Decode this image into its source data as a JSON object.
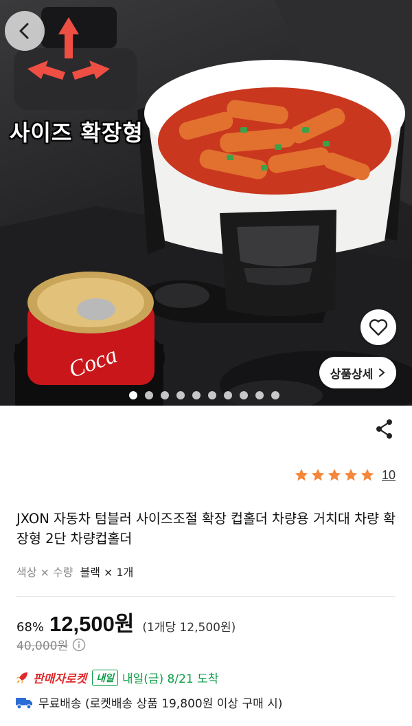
{
  "hero": {
    "size_label": "사이즈 확장형",
    "detail_button_label": "상품상세",
    "carousel": {
      "total": 10,
      "active_index": 0
    }
  },
  "product": {
    "rating": 5,
    "review_count": "10",
    "title": "JXON 자동차 텀블러 사이즈조절 확장 컵홀더 차량용 거치대 차량 확장형 2단 차량컵홀더",
    "option_label": "색상 × 수량",
    "option_value": "블랙 × 1개",
    "discount": "68%",
    "price": "12,500원",
    "unit_price": "(1개당 12,500원)",
    "original_price": "40,000원"
  },
  "delivery": {
    "rocket_label": "판매자로켓",
    "tomorrow_badge": "내일",
    "arrival": "내일(금) 8/21 도착",
    "shipping": "무료배송 (로켓배송 상품 19,800원 이상 구매 시)"
  },
  "colors": {
    "star": "#f5873a",
    "rocket": "#e0292c",
    "arrival": "#0a9d46",
    "shipping_truck": "#2b6bd6"
  }
}
